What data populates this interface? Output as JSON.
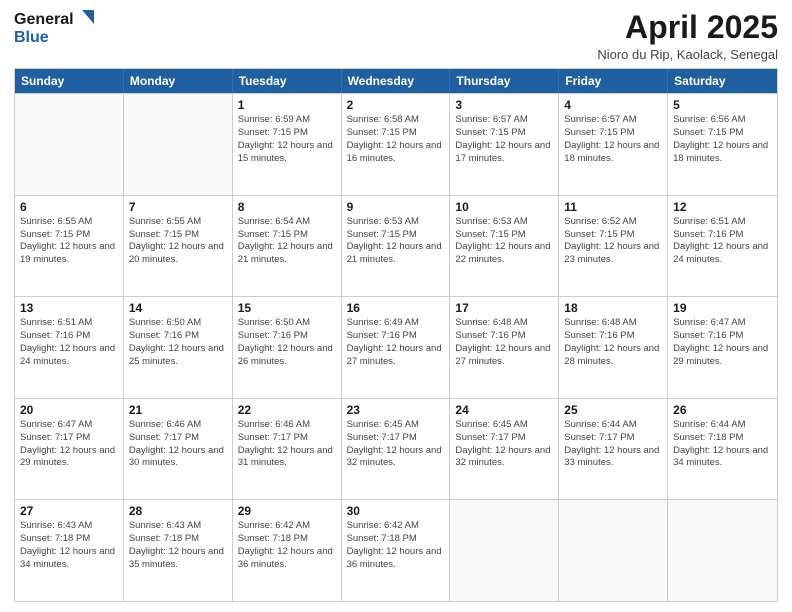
{
  "header": {
    "logo_line1": "General",
    "logo_line2": "Blue",
    "title": "April 2025",
    "location": "Nioro du Rip, Kaolack, Senegal"
  },
  "calendar": {
    "days_of_week": [
      "Sunday",
      "Monday",
      "Tuesday",
      "Wednesday",
      "Thursday",
      "Friday",
      "Saturday"
    ],
    "weeks": [
      [
        {
          "day": "",
          "info": ""
        },
        {
          "day": "",
          "info": ""
        },
        {
          "day": "1",
          "info": "Sunrise: 6:59 AM\nSunset: 7:15 PM\nDaylight: 12 hours and 15 minutes."
        },
        {
          "day": "2",
          "info": "Sunrise: 6:58 AM\nSunset: 7:15 PM\nDaylight: 12 hours and 16 minutes."
        },
        {
          "day": "3",
          "info": "Sunrise: 6:57 AM\nSunset: 7:15 PM\nDaylight: 12 hours and 17 minutes."
        },
        {
          "day": "4",
          "info": "Sunrise: 6:57 AM\nSunset: 7:15 PM\nDaylight: 12 hours and 18 minutes."
        },
        {
          "day": "5",
          "info": "Sunrise: 6:56 AM\nSunset: 7:15 PM\nDaylight: 12 hours and 18 minutes."
        }
      ],
      [
        {
          "day": "6",
          "info": "Sunrise: 6:55 AM\nSunset: 7:15 PM\nDaylight: 12 hours and 19 minutes."
        },
        {
          "day": "7",
          "info": "Sunrise: 6:55 AM\nSunset: 7:15 PM\nDaylight: 12 hours and 20 minutes."
        },
        {
          "day": "8",
          "info": "Sunrise: 6:54 AM\nSunset: 7:15 PM\nDaylight: 12 hours and 21 minutes."
        },
        {
          "day": "9",
          "info": "Sunrise: 6:53 AM\nSunset: 7:15 PM\nDaylight: 12 hours and 21 minutes."
        },
        {
          "day": "10",
          "info": "Sunrise: 6:53 AM\nSunset: 7:15 PM\nDaylight: 12 hours and 22 minutes."
        },
        {
          "day": "11",
          "info": "Sunrise: 6:52 AM\nSunset: 7:15 PM\nDaylight: 12 hours and 23 minutes."
        },
        {
          "day": "12",
          "info": "Sunrise: 6:51 AM\nSunset: 7:16 PM\nDaylight: 12 hours and 24 minutes."
        }
      ],
      [
        {
          "day": "13",
          "info": "Sunrise: 6:51 AM\nSunset: 7:16 PM\nDaylight: 12 hours and 24 minutes."
        },
        {
          "day": "14",
          "info": "Sunrise: 6:50 AM\nSunset: 7:16 PM\nDaylight: 12 hours and 25 minutes."
        },
        {
          "day": "15",
          "info": "Sunrise: 6:50 AM\nSunset: 7:16 PM\nDaylight: 12 hours and 26 minutes."
        },
        {
          "day": "16",
          "info": "Sunrise: 6:49 AM\nSunset: 7:16 PM\nDaylight: 12 hours and 27 minutes."
        },
        {
          "day": "17",
          "info": "Sunrise: 6:48 AM\nSunset: 7:16 PM\nDaylight: 12 hours and 27 minutes."
        },
        {
          "day": "18",
          "info": "Sunrise: 6:48 AM\nSunset: 7:16 PM\nDaylight: 12 hours and 28 minutes."
        },
        {
          "day": "19",
          "info": "Sunrise: 6:47 AM\nSunset: 7:16 PM\nDaylight: 12 hours and 29 minutes."
        }
      ],
      [
        {
          "day": "20",
          "info": "Sunrise: 6:47 AM\nSunset: 7:17 PM\nDaylight: 12 hours and 29 minutes."
        },
        {
          "day": "21",
          "info": "Sunrise: 6:46 AM\nSunset: 7:17 PM\nDaylight: 12 hours and 30 minutes."
        },
        {
          "day": "22",
          "info": "Sunrise: 6:46 AM\nSunset: 7:17 PM\nDaylight: 12 hours and 31 minutes."
        },
        {
          "day": "23",
          "info": "Sunrise: 6:45 AM\nSunset: 7:17 PM\nDaylight: 12 hours and 32 minutes."
        },
        {
          "day": "24",
          "info": "Sunrise: 6:45 AM\nSunset: 7:17 PM\nDaylight: 12 hours and 32 minutes."
        },
        {
          "day": "25",
          "info": "Sunrise: 6:44 AM\nSunset: 7:17 PM\nDaylight: 12 hours and 33 minutes."
        },
        {
          "day": "26",
          "info": "Sunrise: 6:44 AM\nSunset: 7:18 PM\nDaylight: 12 hours and 34 minutes."
        }
      ],
      [
        {
          "day": "27",
          "info": "Sunrise: 6:43 AM\nSunset: 7:18 PM\nDaylight: 12 hours and 34 minutes."
        },
        {
          "day": "28",
          "info": "Sunrise: 6:43 AM\nSunset: 7:18 PM\nDaylight: 12 hours and 35 minutes."
        },
        {
          "day": "29",
          "info": "Sunrise: 6:42 AM\nSunset: 7:18 PM\nDaylight: 12 hours and 36 minutes."
        },
        {
          "day": "30",
          "info": "Sunrise: 6:42 AM\nSunset: 7:18 PM\nDaylight: 12 hours and 36 minutes."
        },
        {
          "day": "",
          "info": ""
        },
        {
          "day": "",
          "info": ""
        },
        {
          "day": "",
          "info": ""
        }
      ]
    ]
  }
}
